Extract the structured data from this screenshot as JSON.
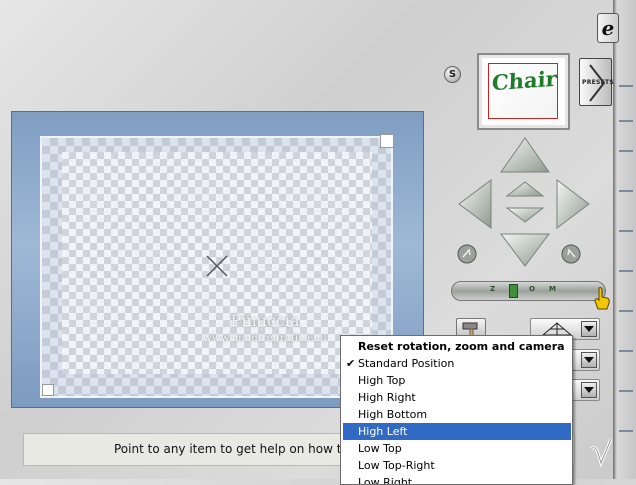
{
  "status_bar": {
    "text": "Point to any item to get help on how to use it."
  },
  "thumbnail": {
    "text": "Chair",
    "alt": "preview-thumbnail"
  },
  "presets_button": {
    "label": "PRESETS"
  },
  "help_icon": {
    "glyph": "e"
  },
  "s_icon": {
    "glyph": "S"
  },
  "zoom_slider": {
    "label": "ZOOM",
    "value_fraction": 0.4
  },
  "watermark": {
    "line1": "Pinuccia",
    "line2": "www.maidiregrafica.eu"
  },
  "popup_menu": {
    "header": "Reset rotation, zoom and camera",
    "items": [
      {
        "label": "Standard Position",
        "checked": true,
        "selected": false
      },
      {
        "label": "High Top",
        "checked": false,
        "selected": false
      },
      {
        "label": "High Right",
        "checked": false,
        "selected": false
      },
      {
        "label": "High Bottom",
        "checked": false,
        "selected": false
      },
      {
        "label": "High Left",
        "checked": false,
        "selected": true
      },
      {
        "label": "Low Top",
        "checked": false,
        "selected": false
      },
      {
        "label": "Low Top-Right",
        "checked": false,
        "selected": false
      },
      {
        "label": "Low Right",
        "checked": false,
        "selected": false
      }
    ]
  },
  "colors": {
    "menu_highlight": "#316ac5",
    "preview_blue": "#7f9ec2",
    "cursor_yellow": "#f2c600"
  },
  "icons": [
    "help-icon",
    "s-icon",
    "presets-arrow-icon",
    "arrow-up-icon",
    "arrow-down-icon",
    "arrow-left-icon",
    "arrow-right-icon",
    "rotate-left-icon",
    "rotate-right-icon",
    "hand-pointer-icon",
    "check-icon",
    "logo-mark-icon",
    "grid-icon",
    "hammer-icon"
  ]
}
